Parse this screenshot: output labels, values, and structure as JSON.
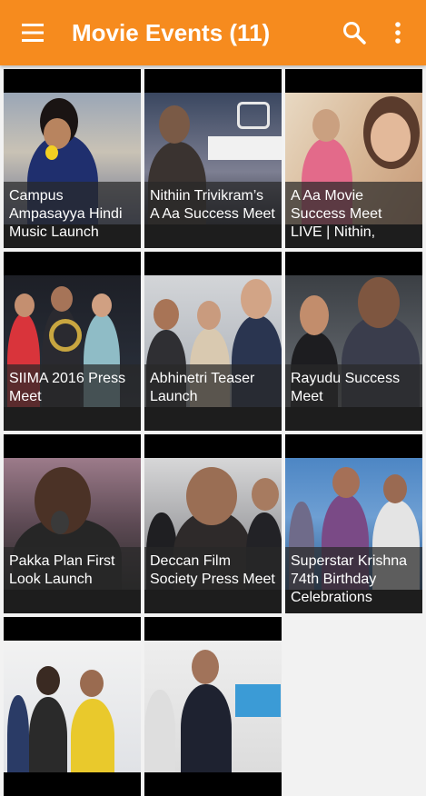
{
  "toolbar": {
    "title": "Movie Events (11)",
    "menu_icon": "hamburger-menu-icon",
    "search_icon": "search-icon",
    "more_icon": "more-vert-icon"
  },
  "colors": {
    "toolbar": "#f68b1e",
    "background": "#f2f2f2"
  },
  "events": [
    {
      "title": "Campus Ampasayya Hindi Music Launch"
    },
    {
      "title": "Nithiin Trivikram’s A Aa Success Meet"
    },
    {
      "title": "A Aa Movie Success Meet LIVE | Nithin,"
    },
    {
      "title": "SIIMA 2016 Press Meet"
    },
    {
      "title": "Abhinetri Teaser Launch"
    },
    {
      "title": "Rayudu Success Meet"
    },
    {
      "title": "Pakka Plan First Look Launch"
    },
    {
      "title": "Deccan Film Society Press Meet"
    },
    {
      "title": "Superstar Krishna 74th Birthday Celebrations"
    },
    {
      "title": ""
    },
    {
      "title": ""
    }
  ]
}
